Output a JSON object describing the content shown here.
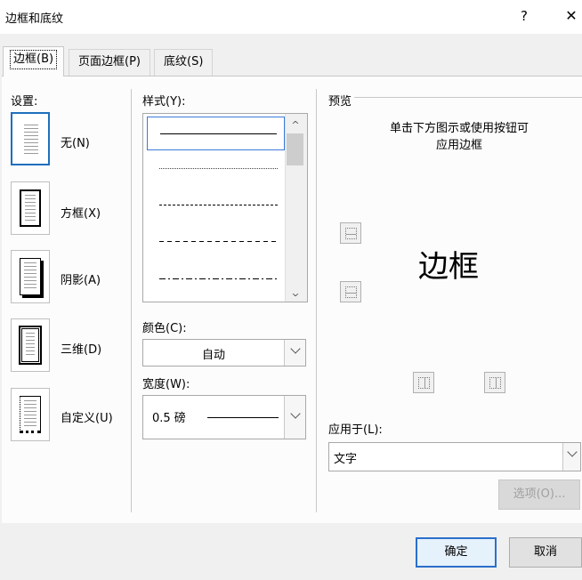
{
  "window": {
    "title": "边框和底纹",
    "help_label": "?",
    "close_label": "✕"
  },
  "tabs": [
    {
      "label": "边框(B)",
      "active": true
    },
    {
      "label": "页面边框(P)",
      "active": false
    },
    {
      "label": "底纹(S)",
      "active": false
    }
  ],
  "settings": {
    "heading": "设置:",
    "items": [
      {
        "label": "无(N)",
        "icon": "setting-none-icon",
        "selected": true
      },
      {
        "label": "方框(X)",
        "icon": "setting-box-icon",
        "selected": false
      },
      {
        "label": "阴影(A)",
        "icon": "setting-shadow-icon",
        "selected": false
      },
      {
        "label": "三维(D)",
        "icon": "setting-3d-icon",
        "selected": false
      },
      {
        "label": "自定义(U)",
        "icon": "setting-custom-icon",
        "selected": false
      }
    ]
  },
  "style": {
    "heading": "样式(Y):",
    "items": [
      "solid",
      "dotted",
      "dashed-small",
      "dashed",
      "dash-dot"
    ],
    "selected_index": 0
  },
  "color": {
    "heading": "颜色(C):",
    "value": "自动"
  },
  "width": {
    "heading": "宽度(W):",
    "value": "0.5 磅"
  },
  "preview": {
    "heading": "预览",
    "hint_line1": "单击下方图示或使用按钮可",
    "hint_line2": "应用边框",
    "sample_text": "边框"
  },
  "apply_to": {
    "heading": "应用于(L):",
    "value": "文字"
  },
  "buttons": {
    "options": "选项(O)...",
    "ok": "确定",
    "cancel": "取消"
  },
  "colors": {
    "accent": "#1f6fbd",
    "primary_border": "#2a6fcb"
  }
}
